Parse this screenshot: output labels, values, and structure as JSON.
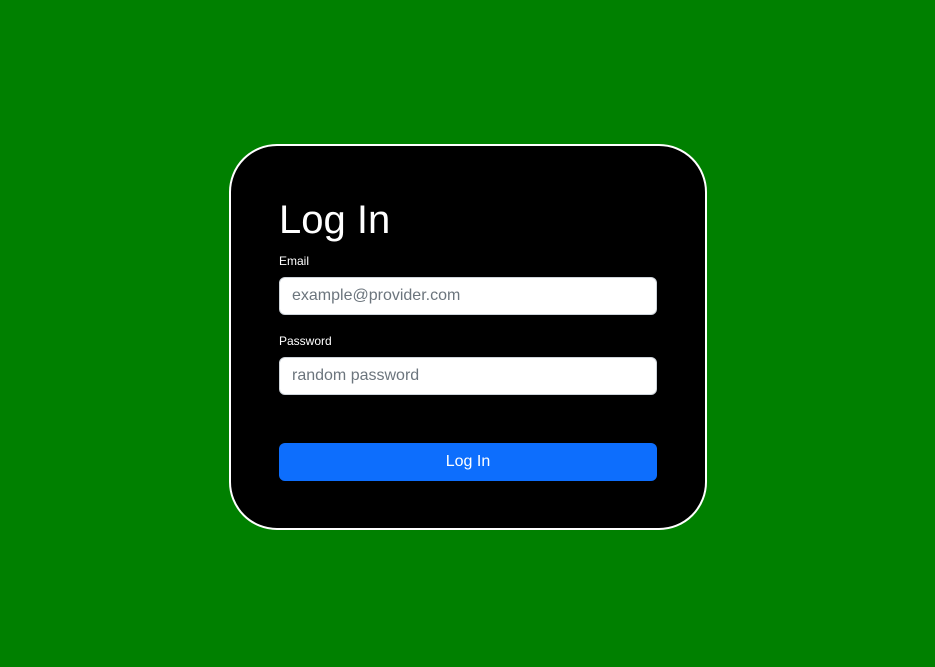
{
  "login": {
    "title": "Log In",
    "email_label": "Email",
    "email_placeholder": "example@provider.com",
    "password_label": "Password",
    "password_placeholder": "random password",
    "submit_label": "Log In"
  },
  "colors": {
    "background": "#008000",
    "card": "#000000",
    "card_border": "#ffffff",
    "button": "#0d6efd"
  }
}
